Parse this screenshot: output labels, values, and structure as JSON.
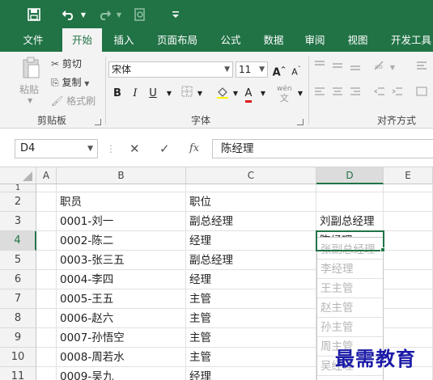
{
  "qat": {
    "save_icon": "save-icon",
    "undo_icon": "undo-icon",
    "redo_icon": "redo-icon",
    "preview_icon": "print-preview-icon",
    "customize_icon": "customize-icon"
  },
  "tabs": [
    "文件",
    "开始",
    "插入",
    "页面布局",
    "公式",
    "数据",
    "审阅",
    "视图",
    "开发工具"
  ],
  "ribbon": {
    "clipboard": {
      "paste": "粘贴",
      "cut": "剪切",
      "copy": "复制",
      "format_painter": "格式刷",
      "label": "剪贴板"
    },
    "font": {
      "name": "宋体",
      "size": "11",
      "bold": "B",
      "italic": "I",
      "underline": "U",
      "grow": "A",
      "shrink": "A",
      "font_color": "A",
      "wen": "wén",
      "wen_zi": "文",
      "label": "字体"
    },
    "alignment": {
      "label": "对齐方式"
    }
  },
  "formula_bar": {
    "name_box": "D4",
    "cancel": "✕",
    "enter": "✓",
    "fx": "fx",
    "value": "陈经理"
  },
  "columns": [
    "A",
    "B",
    "C",
    "D",
    "E"
  ],
  "rows": [
    {
      "num": "1",
      "B": "",
      "C": "",
      "D": ""
    },
    {
      "num": "2",
      "B": "职员",
      "C": "职位",
      "D": ""
    },
    {
      "num": "3",
      "B": "0001-刘一",
      "C": "副总经理",
      "D": "刘副总经理"
    },
    {
      "num": "4",
      "B": "0002-陈二",
      "C": "经理",
      "D": "陈经理"
    },
    {
      "num": "5",
      "B": "0003-张三五",
      "C": "副总经理",
      "D": "张副总经理"
    },
    {
      "num": "6",
      "B": "0004-李四",
      "C": "经理",
      "D": "李经理"
    },
    {
      "num": "7",
      "B": "0005-王五",
      "C": "主管",
      "D": "王主管"
    },
    {
      "num": "8",
      "B": "0006-赵六",
      "C": "主管",
      "D": "赵主管"
    },
    {
      "num": "9",
      "B": "0007-孙悟空",
      "C": "主管",
      "D": "孙主管"
    },
    {
      "num": "10",
      "B": "0008-周若水",
      "C": "主管",
      "D": "周主管"
    },
    {
      "num": "11",
      "B": "0009-吴九",
      "C": "经理",
      "D": "吴经理"
    }
  ],
  "watermark": "最需教育",
  "colors": {
    "excel_green": "#217346",
    "suggestion_gray": "#b5b5b5",
    "watermark_blue": "#1a1aa8"
  }
}
